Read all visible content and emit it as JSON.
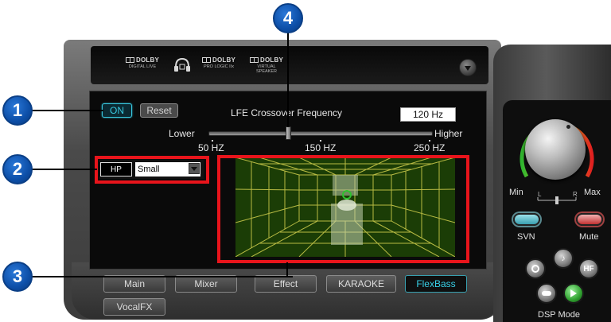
{
  "callouts": [
    "1",
    "2",
    "3",
    "4"
  ],
  "header": {
    "logos": [
      {
        "name": "DOLBY",
        "sub": "DIGITAL LIVE"
      },
      {
        "name": "DOLBY",
        "sub": "PRO LOGIC IIx"
      },
      {
        "name": "DOLBY",
        "sub": "VIRTUAL SPEAKER"
      }
    ],
    "icons": [
      "headphone-icon",
      "menu-dropdown-icon"
    ]
  },
  "flexbass": {
    "on_label": "ON",
    "reset_label": "Reset",
    "crossover_title": "LFE Crossover Frequency",
    "crossover_value": "120 Hz",
    "slider": {
      "lower_label": "Lower",
      "higher_label": "Higher",
      "value_hz": 120,
      "min_hz": 50,
      "max_hz": 250
    },
    "scale": [
      "50 HZ",
      "150 HZ",
      "250 HZ"
    ],
    "speaker_type": "HP",
    "speaker_size": "Small"
  },
  "tabs": [
    {
      "label": "Main",
      "active": false
    },
    {
      "label": "Mixer",
      "active": false
    },
    {
      "label": "Effect",
      "active": false
    },
    {
      "label": "KARAOKE",
      "active": false
    },
    {
      "label": "FlexBass",
      "active": true
    },
    {
      "label": "VocalFX",
      "active": false
    }
  ],
  "side": {
    "min_label": "Min",
    "max_label": "Max",
    "balance": {
      "left": "L",
      "right": "R"
    },
    "svn_label": "SVN",
    "mute_label": "Mute",
    "dsp_label": "DSP Mode",
    "dsp_buttons": [
      "",
      "♪",
      "HF",
      "",
      ""
    ]
  },
  "colors": {
    "accent": "#38d0e8",
    "highlight": "#e8141b",
    "room": "#1b3d06",
    "grid": "#c9c94a",
    "callout": "#0d4fa8"
  }
}
